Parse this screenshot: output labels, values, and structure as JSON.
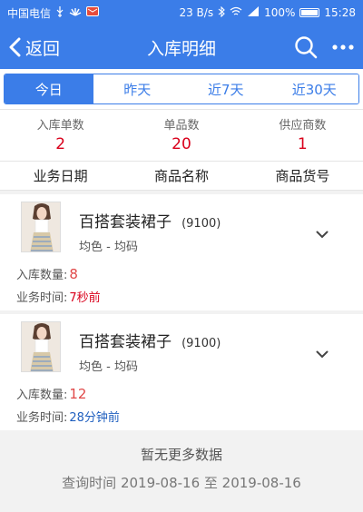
{
  "statusbar": {
    "carrier": "中国电信",
    "speed": "23 B/s",
    "battery": "100%",
    "time": "15:28"
  },
  "navbar": {
    "back_label": "返回",
    "title": "入库明细"
  },
  "tabs": [
    {
      "label": "今日",
      "active": true
    },
    {
      "label": "昨天",
      "active": false
    },
    {
      "label": "近7天",
      "active": false
    },
    {
      "label": "近30天",
      "active": false
    }
  ],
  "summary": [
    {
      "label": "入库单数",
      "value": "2"
    },
    {
      "label": "单品数",
      "value": "20"
    },
    {
      "label": "供应商数",
      "value": "1"
    }
  ],
  "columns": [
    "业务日期",
    "商品名称",
    "商品货号"
  ],
  "records": [
    {
      "name": "百搭套装裙子",
      "code": "(9100)",
      "spec": "均色  -  均码",
      "qty_label": "入库数量:",
      "qty": "8",
      "time_label": "业务时间:",
      "time": "7秒前",
      "time_color": "#d9001b"
    },
    {
      "name": "百搭套装裙子",
      "code": "(9100)",
      "spec": "均色  -  均码",
      "qty_label": "入库数量:",
      "qty": "12",
      "time_label": "业务时间:",
      "time": "28分钟前",
      "time_color": "#1f5fbf"
    }
  ],
  "footer": {
    "no_more": "暂无更多数据",
    "query_time": "查询时间 2019-08-16 至 2019-08-16"
  },
  "colors": {
    "accent": "#3b7de8",
    "value_red": "#d9001b"
  }
}
